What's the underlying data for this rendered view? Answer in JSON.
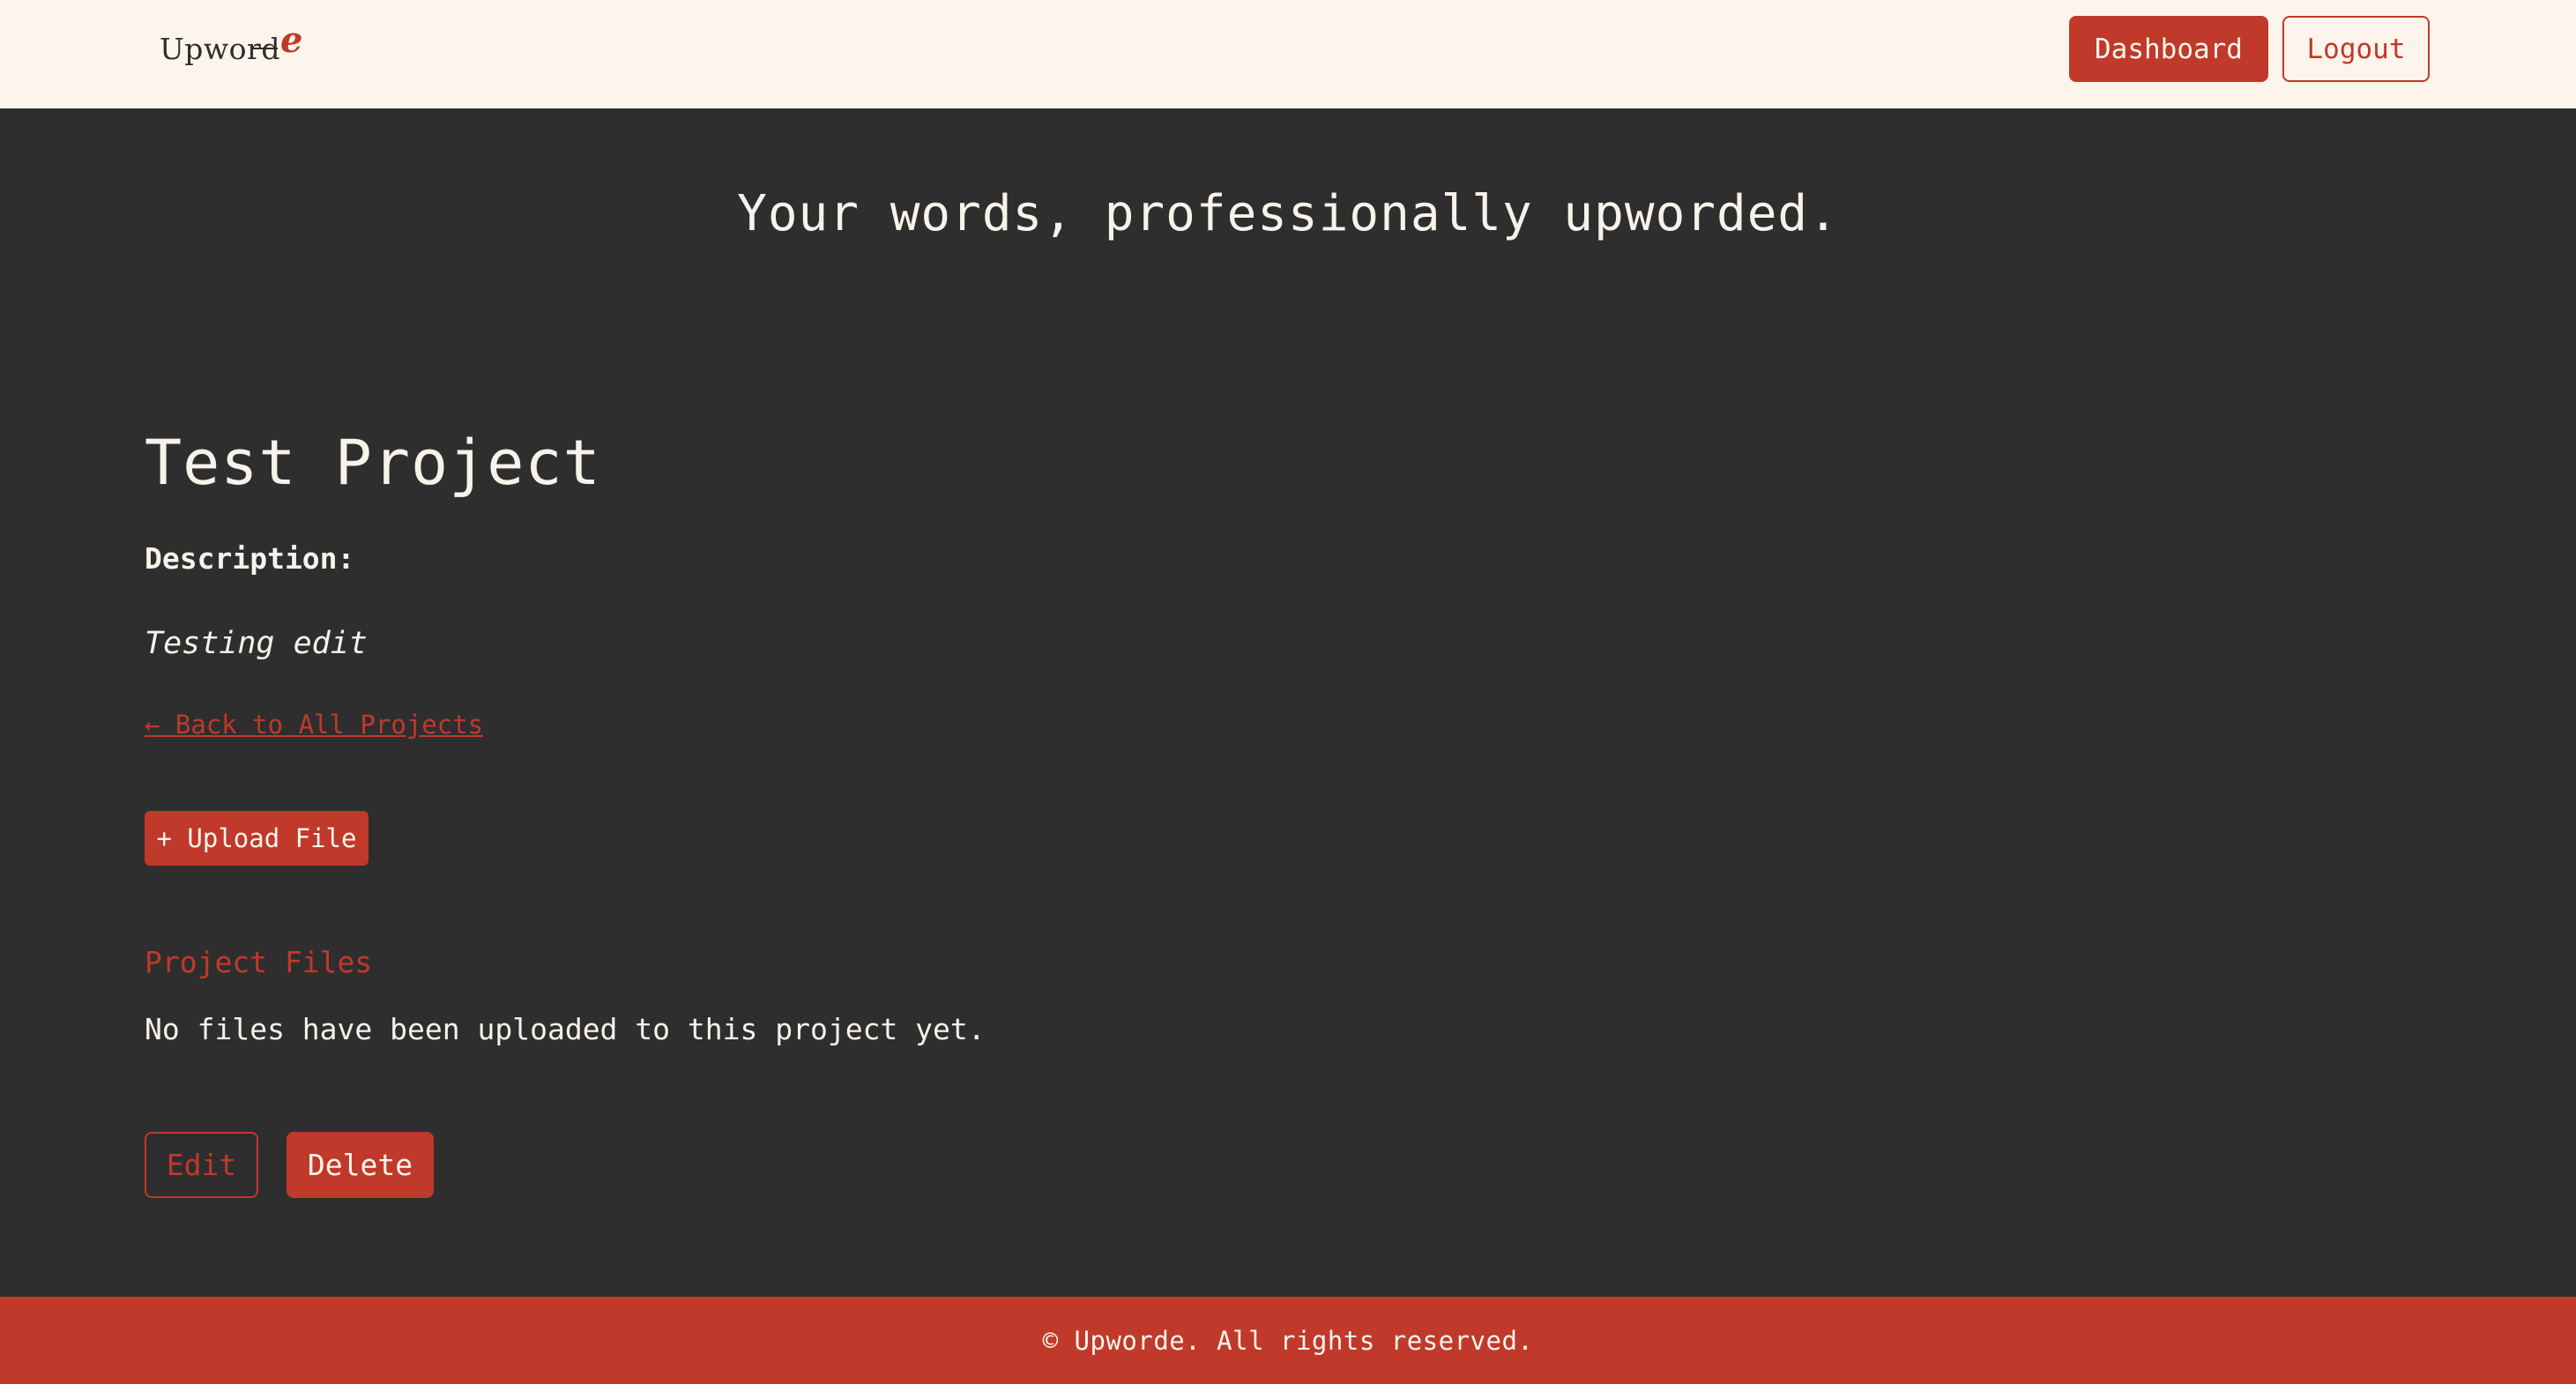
{
  "header": {
    "logo_text": "Upword",
    "logo_accent": "e",
    "nav": {
      "dashboard_label": "Dashboard",
      "logout_label": "Logout"
    }
  },
  "hero": {
    "tagline": "Your words, professionally upworded."
  },
  "project": {
    "title": "Test Project",
    "description_label": "Description:",
    "description": "Testing edit",
    "back_link": "← Back to All Projects",
    "upload_label": "+ Upload File",
    "files_heading": "Project Files",
    "files_empty": "No files have been uploaded to this project yet.",
    "edit_label": "Edit",
    "delete_label": "Delete"
  },
  "footer": {
    "text": "© Upworde. All rights reserved."
  },
  "colors": {
    "accent": "#c0392b",
    "background": "#2e2e2e",
    "header_bg": "#fdf5eb"
  }
}
